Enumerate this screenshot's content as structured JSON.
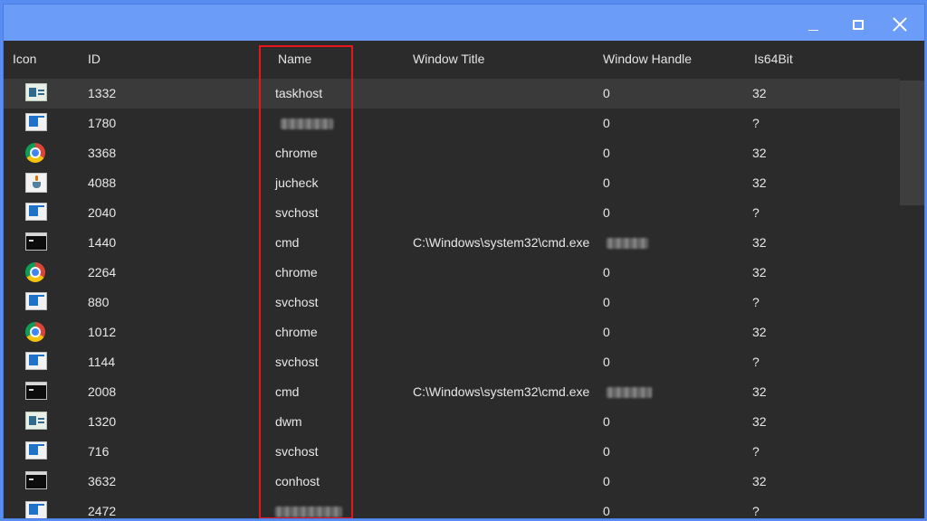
{
  "window": {
    "controls": {
      "minimize": "minimize",
      "maximize": "maximize",
      "close": "close"
    }
  },
  "columns": [
    "Icon",
    "ID",
    "Name",
    "Window Title",
    "Window Handle",
    "Is64Bit"
  ],
  "rows": [
    {
      "icon": "host-icon",
      "id": "1332",
      "name": "taskhost",
      "title": "",
      "handle": "0",
      "bits": "32",
      "selected": true
    },
    {
      "icon": "exe-icon",
      "id": "1780",
      "name": "",
      "name_redacted": true,
      "title": "",
      "handle": "0",
      "bits": "?"
    },
    {
      "icon": "chrome-icon",
      "id": "3368",
      "name": "chrome",
      "title": "",
      "handle": "0",
      "bits": "32"
    },
    {
      "icon": "java-icon",
      "id": "4088",
      "name": "jucheck",
      "title": "",
      "handle": "0",
      "bits": "32"
    },
    {
      "icon": "exe-icon",
      "id": "2040",
      "name": "svchost",
      "title": "",
      "handle": "0",
      "bits": "?"
    },
    {
      "icon": "cmd-icon",
      "id": "1440",
      "name": "cmd",
      "title": "C:\\Windows\\system32\\cmd.exe",
      "handle": "",
      "handle_redacted": true,
      "bits": "32"
    },
    {
      "icon": "chrome-icon",
      "id": "2264",
      "name": "chrome",
      "title": "",
      "handle": "0",
      "bits": "32"
    },
    {
      "icon": "exe-icon",
      "id": "880",
      "name": "svchost",
      "title": "",
      "handle": "0",
      "bits": "?"
    },
    {
      "icon": "chrome-icon",
      "id": "1012",
      "name": "chrome",
      "title": "",
      "handle": "0",
      "bits": "32"
    },
    {
      "icon": "exe-icon",
      "id": "1144",
      "name": "svchost",
      "title": "",
      "handle": "0",
      "bits": "?"
    },
    {
      "icon": "cmd-icon",
      "id": "2008",
      "name": "cmd",
      "title": "C:\\Windows\\system32\\cmd.exe",
      "handle": "",
      "handle_redacted": true,
      "bits": "32"
    },
    {
      "icon": "host-icon",
      "id": "1320",
      "name": "dwm",
      "title": "",
      "handle": "0",
      "bits": "32"
    },
    {
      "icon": "exe-icon",
      "id": "716",
      "name": "svchost",
      "title": "",
      "handle": "0",
      "bits": "?"
    },
    {
      "icon": "cmd-icon",
      "id": "3632",
      "name": "conhost",
      "title": "",
      "handle": "0",
      "bits": "32"
    },
    {
      "icon": "exe-icon",
      "id": "2472",
      "name": "",
      "name_redacted": true,
      "title": "",
      "handle": "0",
      "bits": "?"
    }
  ],
  "colors": {
    "titlebar": "#6b9cf7",
    "grid_bg": "#2b2b2b",
    "selected_row": "#3a3a3a",
    "highlight_box": "#e8151b"
  }
}
